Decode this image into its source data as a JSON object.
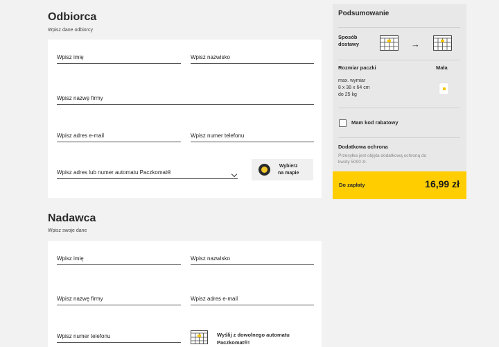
{
  "recipient": {
    "title": "Odbiorca",
    "subtitle": "Wpisz dane odbiorcy",
    "first_name": "Wpisz imię",
    "last_name": "Wpisz nazwisko",
    "company": "Wpisz nazwę firmy",
    "email": "Wpisz adres e-mail",
    "phone": "Wpisz numer telefonu",
    "address": "Wpisz adres lub numer automatu Paczkomat®",
    "map_button_line1": "Wybierz",
    "map_button_line2": "na mapie"
  },
  "sender": {
    "title": "Nadawca",
    "subtitle": "Wpisz swoje dane",
    "first_name": "Wpisz imię",
    "last_name": "Wpisz nazwisko",
    "company": "Wpisz nazwę firmy",
    "email": "Wpisz adres e-mail",
    "phone": "Wpisz numer telefonu",
    "send_any_line1": "Wyślij z dowolnego automatu",
    "send_any_line2": "Paczkomat®!"
  },
  "summary": {
    "title": "Podsumowanie",
    "delivery_method_line1": "Sposób",
    "delivery_method_line2": "dostawy",
    "parcel_size_label": "Rozmiar paczki",
    "parcel_size_value": "Mała",
    "dims_line1": "max. wymiar",
    "dims_line2": "8 x 38 x 64 cm",
    "dims_line3": "do 25 kg",
    "discount_code": "Mam kod rabatowy",
    "protection_title": "Dodatkowa ochrona",
    "protection_line1": "Przesyłka jest objęta dodatkową ochroną do",
    "protection_line2": "kwoty 5000 zł.",
    "to_pay_label": "Do zapłaty",
    "price": "16,99 zł",
    "accent_color": "#ffcd00"
  },
  "icons": {
    "locker": "parcel-locker-icon",
    "arrow": "arrow-right-icon",
    "pin": "map-pin-icon",
    "package": "small-package-icon",
    "chevron": "chevron-down-icon"
  }
}
